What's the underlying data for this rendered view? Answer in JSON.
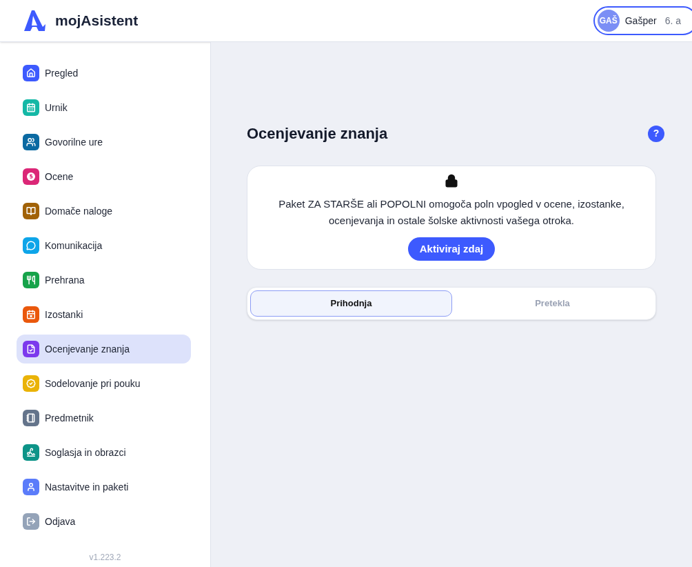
{
  "header": {
    "logo_text": "mojAsistent",
    "user": {
      "initials": "GAŠ",
      "name": "Gašper",
      "class": "6. a"
    }
  },
  "sidebar": {
    "items": [
      {
        "label": "Pregled",
        "kind": "home",
        "color": "#3d5afe",
        "selected": false
      },
      {
        "label": "Urnik",
        "kind": "calendar",
        "color": "#14b8a6",
        "selected": false
      },
      {
        "label": "Govorilne ure",
        "kind": "meeting",
        "color": "#0b6aa2",
        "selected": false
      },
      {
        "label": "Ocene",
        "kind": "grade",
        "color": "#db2777",
        "selected": false
      },
      {
        "label": "Domače naloge",
        "kind": "book",
        "color": "#a16207",
        "selected": false
      },
      {
        "label": "Komunikacija",
        "kind": "chat",
        "color": "#0ea5e9",
        "selected": false
      },
      {
        "label": "Prehrana",
        "kind": "food",
        "color": "#16a34a",
        "selected": false
      },
      {
        "label": "Izostanki",
        "kind": "absence",
        "color": "#ea580c",
        "selected": false
      },
      {
        "label": "Ocenjevanje znanja",
        "kind": "test",
        "color": "#7c3aed",
        "selected": true
      },
      {
        "label": "Sodelovanje pri pouku",
        "kind": "badge",
        "color": "#eab308",
        "selected": false
      },
      {
        "label": "Predmetnik",
        "kind": "notebook",
        "color": "#64748b",
        "selected": false
      },
      {
        "label": "Soglasja in obrazci",
        "kind": "signature",
        "color": "#0d9488",
        "selected": false
      },
      {
        "label": "Nastavitve in paketi",
        "kind": "user",
        "color": "#5b7cfa",
        "selected": false
      },
      {
        "label": "Odjava",
        "kind": "logout",
        "color": "#94a3b8",
        "selected": false
      }
    ],
    "version": "v1.223.2"
  },
  "main": {
    "title": "Ocenjevanje znanja",
    "help": "?",
    "upsell": {
      "text": "Paket ZA STARŠE ali POPOLNI omogoča poln vpogled v ocene, izostanke, ocenjevanja in ostale šolske aktivnosti vašega otroka.",
      "button": "Aktiviraj zdaj"
    },
    "tabs": [
      {
        "label": "Prihodnja",
        "selected": true
      },
      {
        "label": "Pretekla",
        "selected": false
      }
    ]
  }
}
